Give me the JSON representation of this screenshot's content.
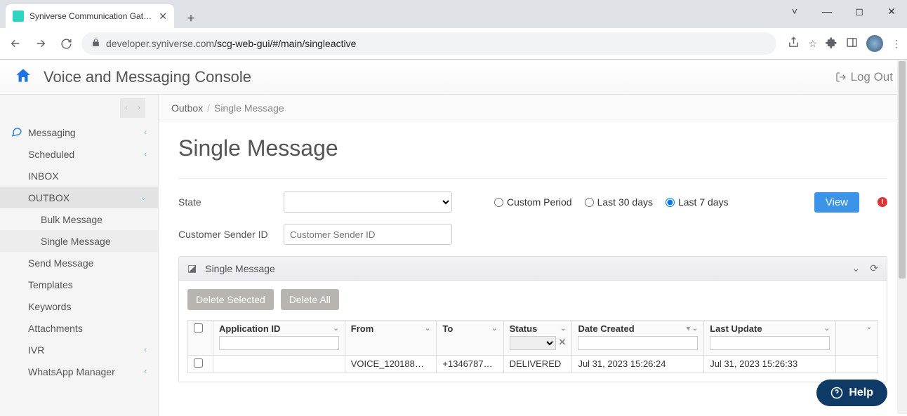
{
  "browser": {
    "tab_title": "Syniverse Communication Gatew",
    "url_host": "developer.syniverse.com",
    "url_path": "/scg-web-gui/#/main/singleactive"
  },
  "app": {
    "title": "Voice and Messaging Console",
    "logout": "Log Out"
  },
  "sidebar": {
    "section": "Messaging",
    "items": [
      "Scheduled",
      "INBOX",
      "OUTBOX",
      "Send Message",
      "Templates",
      "Keywords",
      "Attachments",
      "IVR",
      "WhatsApp Manager"
    ],
    "outbox_children": [
      "Bulk Message",
      "Single Message"
    ]
  },
  "breadcrumb": {
    "parent": "Outbox",
    "current": "Single Message"
  },
  "page": {
    "title": "Single Message"
  },
  "filters": {
    "state_label": "State",
    "sender_label": "Customer Sender ID",
    "sender_placeholder": "Customer Sender ID",
    "period_custom": "Custom Period",
    "period_30": "Last 30 days",
    "period_7": "Last 7 days",
    "view_btn": "View"
  },
  "panel": {
    "title": "Single Message",
    "delete_selected": "Delete Selected",
    "delete_all": "Delete All"
  },
  "table": {
    "headers": [
      "Application ID",
      "From",
      "To",
      "Status",
      "Date Created",
      "Last Update"
    ],
    "rows": [
      {
        "app_id": "",
        "from": "VOICE_120188…",
        "to": "+1346787…",
        "status": "DELIVERED",
        "created": "Jul 31, 2023 15:26:24",
        "updated": "Jul 31, 2023 15:26:33"
      }
    ]
  },
  "help": "Help"
}
